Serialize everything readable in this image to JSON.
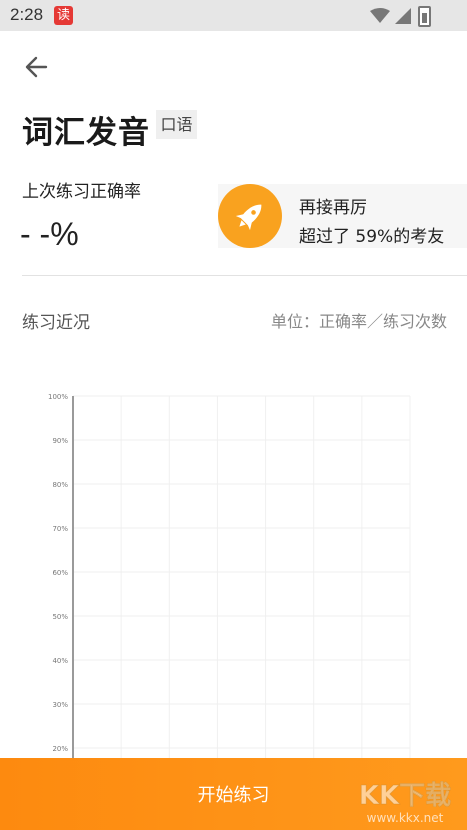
{
  "status_bar": {
    "time": "2:28",
    "app_icon_text": "读"
  },
  "header": {
    "title": "词汇发音",
    "tag": "口语",
    "back_icon": "arrow-left-icon"
  },
  "stats": {
    "last_label": "上次练习正确率",
    "last_value": "- -%",
    "encourage_line1": "再接再厉",
    "encourage_line2": "超过了 59%的考友",
    "rocket_icon": "rocket-icon"
  },
  "recent": {
    "label": "练习近况",
    "unit": "单位：正确率／练习次数"
  },
  "chart_data": {
    "type": "line",
    "ytick_labels": [
      "100%",
      "90%",
      "80%",
      "70%",
      "60%",
      "50%",
      "40%",
      "30%",
      "20%"
    ],
    "ylim": [
      20,
      100
    ],
    "series": [],
    "grid": true
  },
  "footer": {
    "start_label": "开始练习"
  },
  "colors": {
    "accent": "#fd8a0f",
    "rocket_bg": "#f9a21f"
  }
}
